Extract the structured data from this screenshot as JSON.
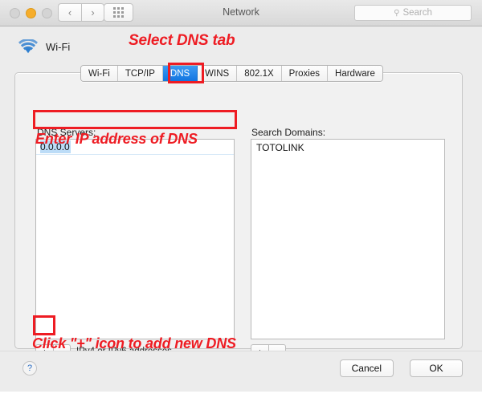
{
  "window": {
    "title": "Network",
    "traffic_lights": [
      "close",
      "minimize",
      "zoom"
    ],
    "nav_back_icon": "‹",
    "nav_forward_icon": "›",
    "grid_icon": "show-all-icon"
  },
  "search": {
    "icon": "search-icon",
    "placeholder": "Search",
    "value": ""
  },
  "service": {
    "icon": "wifi-icon",
    "name": "Wi-Fi"
  },
  "tabs": [
    {
      "label": "Wi-Fi",
      "selected": false
    },
    {
      "label": "TCP/IP",
      "selected": false
    },
    {
      "label": "DNS",
      "selected": true
    },
    {
      "label": "WINS",
      "selected": false
    },
    {
      "label": "802.1X",
      "selected": false
    },
    {
      "label": "Proxies",
      "selected": false
    },
    {
      "label": "Hardware",
      "selected": false
    }
  ],
  "dns": {
    "label": "DNS Servers:",
    "entries": [
      "0.0.0.0"
    ],
    "selected_entry": "0.0.0.0",
    "add_button": "+",
    "remove_button": "−",
    "hint": "IPv4 or IPv6 addresses"
  },
  "search_domains": {
    "label": "Search Domains:",
    "entries": [
      "TOTOLINK"
    ],
    "add_button": "+",
    "remove_button": "−"
  },
  "footer": {
    "help_label": "?",
    "cancel_label": "Cancel",
    "ok_label": "OK"
  },
  "annotations": {
    "select_dns_tab": "Select DNS tab",
    "enter_ip": "Enter IP address of DNS",
    "click_plus": "Click \"+\" icon to add new DNS",
    "highlight_color": "#ee1c23"
  },
  "colors": {
    "accent_blue": "#1275e0",
    "wifi_blue": "#2f7fd0",
    "selection_blue": "#bcdcf7",
    "window_bg": "#ececec",
    "annotation_red": "#ee1c23"
  }
}
